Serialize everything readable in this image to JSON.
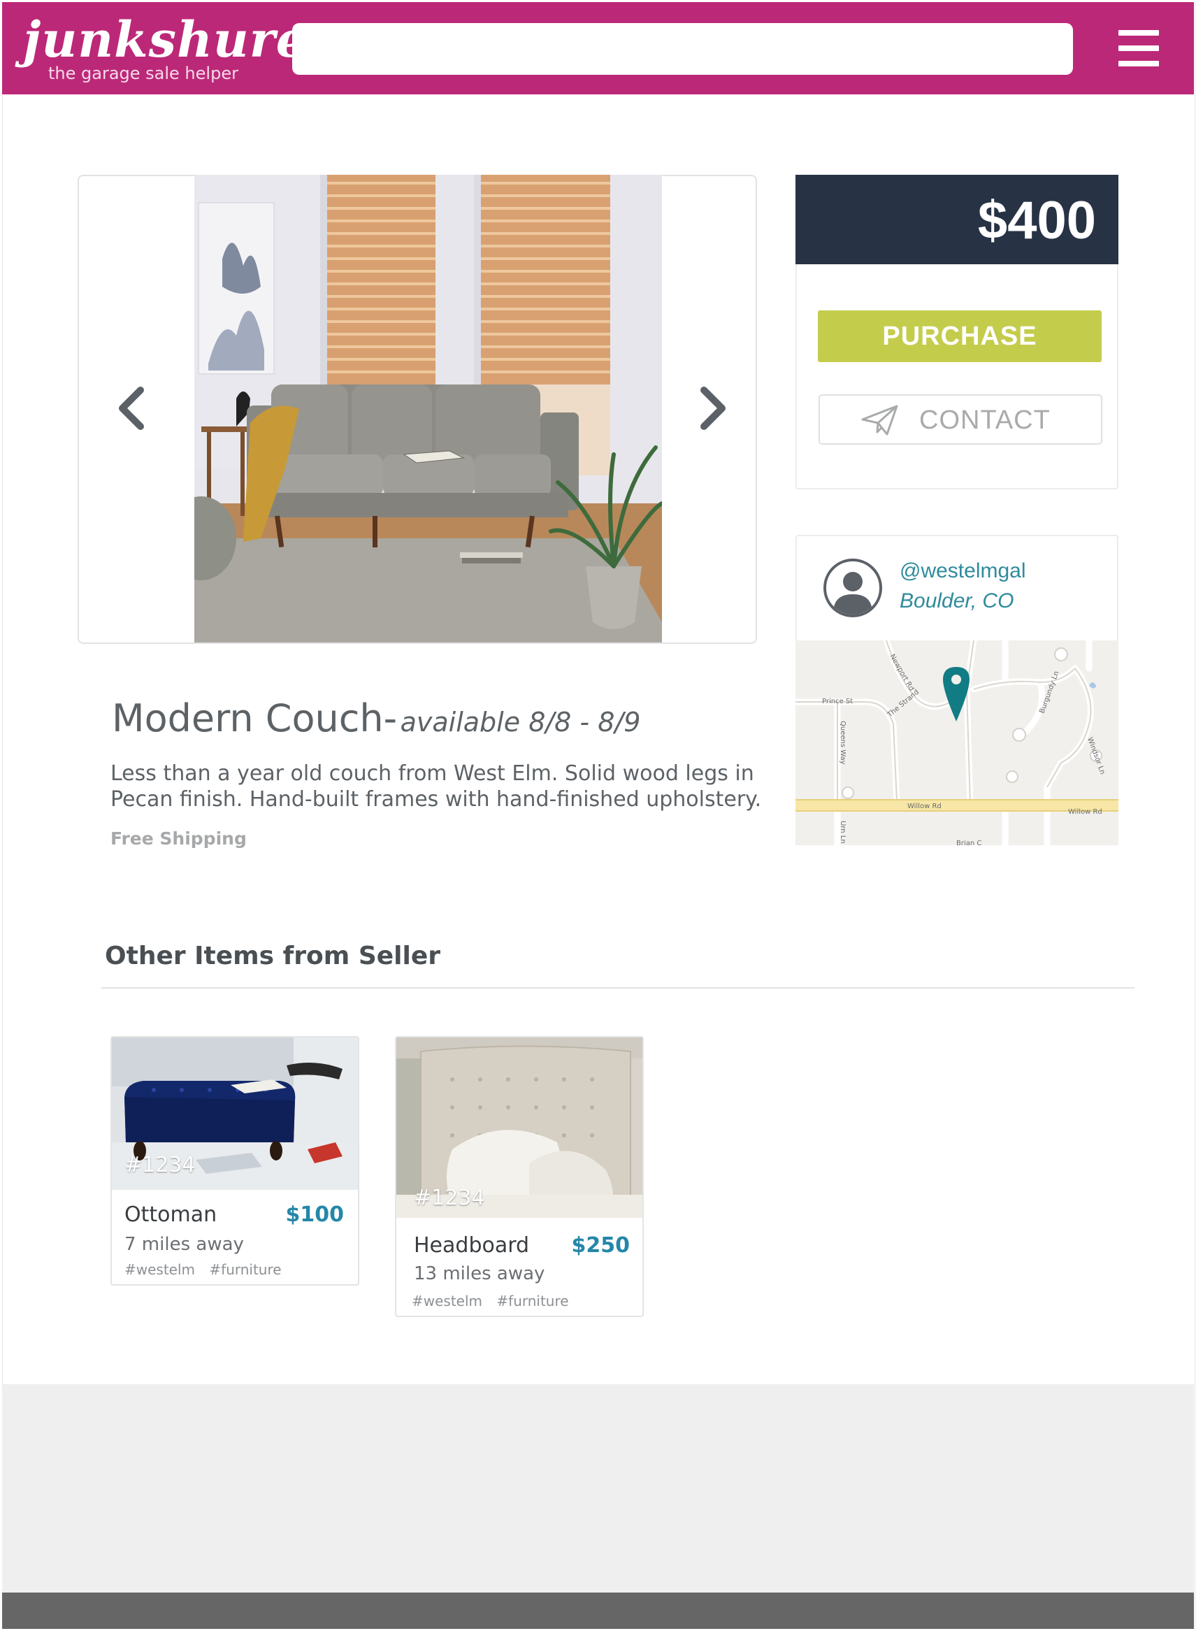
{
  "brand": {
    "name": "junkshure",
    "tagline": "the garage sale helper",
    "header_color": "#bc2878"
  },
  "search": {
    "placeholder": "",
    "value": ""
  },
  "listing": {
    "price": "$400",
    "title": "Modern Couch-",
    "availability": "available 8/8 - 8/9",
    "description": "Less than a year old couch from West Elm. Solid wood legs in Pecan finish. Hand-built frames with hand-finished upholstery.",
    "shipping": "Free Shipping",
    "purchase_label": "PURCHASE",
    "contact_label": "CONTACT"
  },
  "seller": {
    "handle": "@westelmgal",
    "location": "Boulder, CO",
    "map_labels": {
      "newport": "Newport Rd",
      "prince": "Prince St",
      "strand": "The Strand",
      "queens": "Queens Way",
      "burgundy": "Burgundy Ln",
      "windsor": "Windsor Ln",
      "willow1": "Willow Rd",
      "willow2": "Willow Rd",
      "brian": "Brian C",
      "urn": "Urn Ln"
    }
  },
  "other_items": {
    "heading": "Other Items from Seller",
    "items": [
      {
        "id": "#1234",
        "name": "Ottoman",
        "price": "$100",
        "distance": "7 miles away",
        "tags": [
          "#westelm",
          "#furniture"
        ]
      },
      {
        "id": "#1234",
        "name": "Headboard",
        "price": "$250",
        "distance": "13 miles away",
        "tags": [
          "#westelm",
          "#furniture"
        ]
      }
    ]
  },
  "icons": [
    "hamburger-menu-icon",
    "chevron-left-icon",
    "chevron-right-icon",
    "paper-plane-icon",
    "user-avatar-icon",
    "map-pin-icon"
  ],
  "colors": {
    "price_bar": "#273345",
    "purchase": "#c4cc4c",
    "accent_teal": "#2f8b9c",
    "item_price": "#2587a8"
  }
}
